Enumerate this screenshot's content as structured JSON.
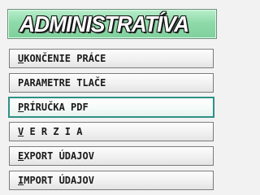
{
  "header": {
    "title": "ADMINISTRATÍVA"
  },
  "menu": {
    "items": [
      {
        "accel": "U",
        "rest": "KONČENIE PRÁCE"
      },
      {
        "accel": "",
        "rest": "PARAMETRE TLAČE"
      },
      {
        "accel": "P",
        "rest": "RÍRUČKA PDF"
      },
      {
        "accel": "V",
        "rest": " E R Z I A"
      },
      {
        "accel": "E",
        "rest": "XPORT ÚDAJOV"
      },
      {
        "accel": "I",
        "rest": "MPORT ÚDAJOV"
      }
    ],
    "selected_index": 2
  },
  "colors": {
    "title_gradient_top": "#b8efcc",
    "title_gradient_bottom": "#7fd09c",
    "selection_outline": "#2f8f86",
    "panel_background": "#f2f2f2"
  }
}
